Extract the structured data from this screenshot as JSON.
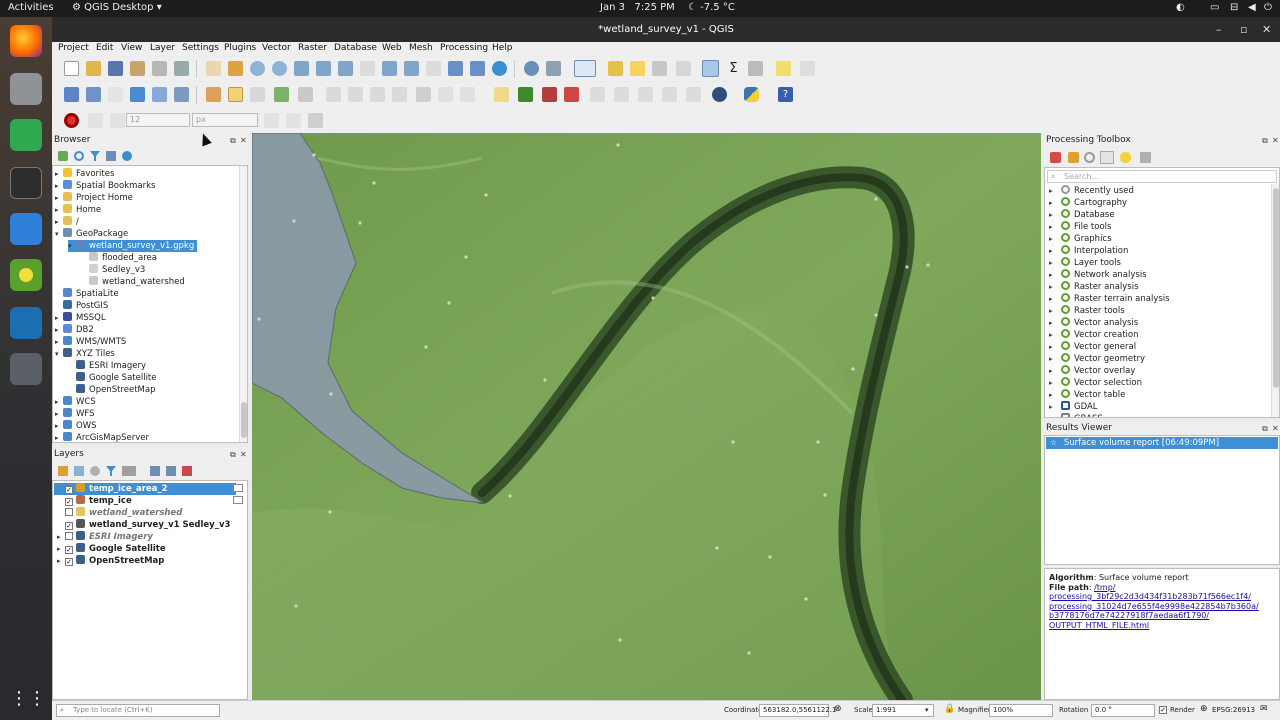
{
  "topbar": {
    "activities": "Activities",
    "app": "QGIS Desktop",
    "date": "Jan 3",
    "time": "7:25 PM",
    "weather": "-7.5 °C"
  },
  "window": {
    "title": "*wetland_survey_v1 - QGIS"
  },
  "menu": [
    "Project",
    "Edit",
    "View",
    "Layer",
    "Settings",
    "Plugins",
    "Vector",
    "Raster",
    "Database",
    "Web",
    "Mesh",
    "Processing",
    "Help"
  ],
  "snapping": {
    "tolerance": "12",
    "unit": "px"
  },
  "browser": {
    "title": "Browser",
    "items": [
      {
        "label": "Favorites",
        "icon": "star-icon",
        "depth": 0,
        "arrow": "▸"
      },
      {
        "label": "Spatial Bookmarks",
        "icon": "bookmark-icon",
        "depth": 0,
        "arrow": "▸"
      },
      {
        "label": "Project Home",
        "icon": "folder-icon",
        "depth": 0,
        "arrow": "▸"
      },
      {
        "label": "Home",
        "icon": "folder-icon",
        "depth": 0,
        "arrow": "▸"
      },
      {
        "label": "/",
        "icon": "folder-icon",
        "depth": 0,
        "arrow": "▸"
      },
      {
        "label": "GeoPackage",
        "icon": "geopackage-icon",
        "depth": 0,
        "arrow": "▾"
      },
      {
        "label": "wetland_survey_v1.gpkg",
        "icon": "gpkg-file-icon",
        "depth": 1,
        "arrow": "▾",
        "selected": true
      },
      {
        "label": "flooded_area",
        "icon": "polygon-layer-icon",
        "depth": 2,
        "arrow": ""
      },
      {
        "label": "Sedley_v3",
        "icon": "point-layer-icon",
        "depth": 2,
        "arrow": ""
      },
      {
        "label": "wetland_watershed",
        "icon": "polygon-layer-icon",
        "depth": 2,
        "arrow": ""
      },
      {
        "label": "SpatiaLite",
        "icon": "spatialite-icon",
        "depth": 0,
        "arrow": ""
      },
      {
        "label": "PostGIS",
        "icon": "postgis-icon",
        "depth": 0,
        "arrow": ""
      },
      {
        "label": "MSSQL",
        "icon": "mssql-icon",
        "depth": 0,
        "arrow": "▸"
      },
      {
        "label": "DB2",
        "icon": "db2-icon",
        "depth": 0,
        "arrow": "▸"
      },
      {
        "label": "WMS/WMTS",
        "icon": "globe-icon",
        "depth": 0,
        "arrow": "▸"
      },
      {
        "label": "XYZ Tiles",
        "icon": "tiles-icon",
        "depth": 0,
        "arrow": "▾"
      },
      {
        "label": "ESRI Imagery",
        "icon": "tiles-icon",
        "depth": 1,
        "arrow": ""
      },
      {
        "label": "Google Satellite",
        "icon": "tiles-icon",
        "depth": 1,
        "arrow": ""
      },
      {
        "label": "OpenStreetMap",
        "icon": "tiles-icon",
        "depth": 1,
        "arrow": ""
      },
      {
        "label": "WCS",
        "icon": "globe-icon",
        "depth": 0,
        "arrow": "▸"
      },
      {
        "label": "WFS",
        "icon": "globe-icon",
        "depth": 0,
        "arrow": "▸"
      },
      {
        "label": "OWS",
        "icon": "globe-icon",
        "depth": 0,
        "arrow": "▸"
      },
      {
        "label": "ArcGisMapServer",
        "icon": "globe-icon",
        "depth": 0,
        "arrow": "▸"
      }
    ]
  },
  "layers": {
    "title": "Layers",
    "items": [
      {
        "label": "temp_ice_area_2",
        "checked": true,
        "bold": true,
        "italic": false,
        "selected": true,
        "icon": "edit-polygon-icon",
        "depth": 0
      },
      {
        "label": "temp_ice",
        "checked": true,
        "bold": true,
        "italic": false,
        "icon": "raster-icon",
        "depth": 0
      },
      {
        "label": "wetland_watershed",
        "checked": false,
        "bold": true,
        "italic": true,
        "icon": "polygon-style-icon",
        "depth": 0
      },
      {
        "label": "wetland_survey_v1 Sedley_v3",
        "checked": true,
        "bold": true,
        "italic": false,
        "icon": "point-style-icon",
        "depth": 0
      },
      {
        "label": "ESRI Imagery",
        "checked": false,
        "bold": true,
        "italic": true,
        "icon": "tiles-icon",
        "depth": 0,
        "arrow": "▸"
      },
      {
        "label": "Google Satellite",
        "checked": true,
        "bold": true,
        "italic": false,
        "icon": "tiles-icon",
        "depth": 0,
        "arrow": "▸"
      },
      {
        "label": "OpenStreetMap",
        "checked": true,
        "bold": true,
        "italic": false,
        "icon": "tiles-icon",
        "depth": 0,
        "arrow": "▸"
      }
    ]
  },
  "toolbox": {
    "title": "Processing Toolbox",
    "search_placeholder": "Search...",
    "items": [
      {
        "label": "Recently used",
        "icon": "clock-icon"
      },
      {
        "label": "Cartography",
        "icon": "q-icon"
      },
      {
        "label": "Database",
        "icon": "q-icon"
      },
      {
        "label": "File tools",
        "icon": "q-icon"
      },
      {
        "label": "Graphics",
        "icon": "q-icon"
      },
      {
        "label": "Interpolation",
        "icon": "q-icon"
      },
      {
        "label": "Layer tools",
        "icon": "q-icon"
      },
      {
        "label": "Network analysis",
        "icon": "q-icon"
      },
      {
        "label": "Raster analysis",
        "icon": "q-icon"
      },
      {
        "label": "Raster terrain analysis",
        "icon": "q-icon"
      },
      {
        "label": "Raster tools",
        "icon": "q-icon"
      },
      {
        "label": "Vector analysis",
        "icon": "q-icon"
      },
      {
        "label": "Vector creation",
        "icon": "q-icon"
      },
      {
        "label": "Vector general",
        "icon": "q-icon"
      },
      {
        "label": "Vector geometry",
        "icon": "q-icon"
      },
      {
        "label": "Vector overlay",
        "icon": "q-icon"
      },
      {
        "label": "Vector selection",
        "icon": "q-icon"
      },
      {
        "label": "Vector table",
        "icon": "q-icon"
      },
      {
        "label": "GDAL",
        "icon": "gdal-icon"
      },
      {
        "label": "GRASS",
        "icon": "grass-icon"
      }
    ]
  },
  "results": {
    "title": "Results Viewer",
    "items": [
      "Surface volume report [06:49:09PM]"
    ],
    "algorithm_label": "Algorithm",
    "algorithm_value": ": Surface volume report",
    "filepath_label": "File path",
    "filepath_colon": ": ",
    "filepath_lines": [
      "/tmp/",
      "processing_3bf29c2d3d434f31b283b71f566ec1f4/",
      "processing_31024d7e655f4e9998e422854b7b360a/",
      "b3778176d7e74227918f7aedaa6f1790/",
      "OUTPUT_HTML_FILE.html"
    ]
  },
  "status": {
    "locate_placeholder": "Type to locate (Ctrl+K)",
    "coordinate_label": "Coordinate",
    "coordinate_value": "563182.0,5561122.1",
    "scale_label": "Scale",
    "scale_value": "1:991",
    "magnifier_label": "Magnifier",
    "magnifier_value": "100%",
    "rotation_label": "Rotation",
    "rotation_value": "0.0 °",
    "render_label": "Render",
    "crs": "EPSG:26913"
  },
  "colors": {
    "selection": "#3d8fd6",
    "polygon_fill": "#8a9aa6",
    "grass": "#7aa357",
    "river": "#2f4a24"
  }
}
